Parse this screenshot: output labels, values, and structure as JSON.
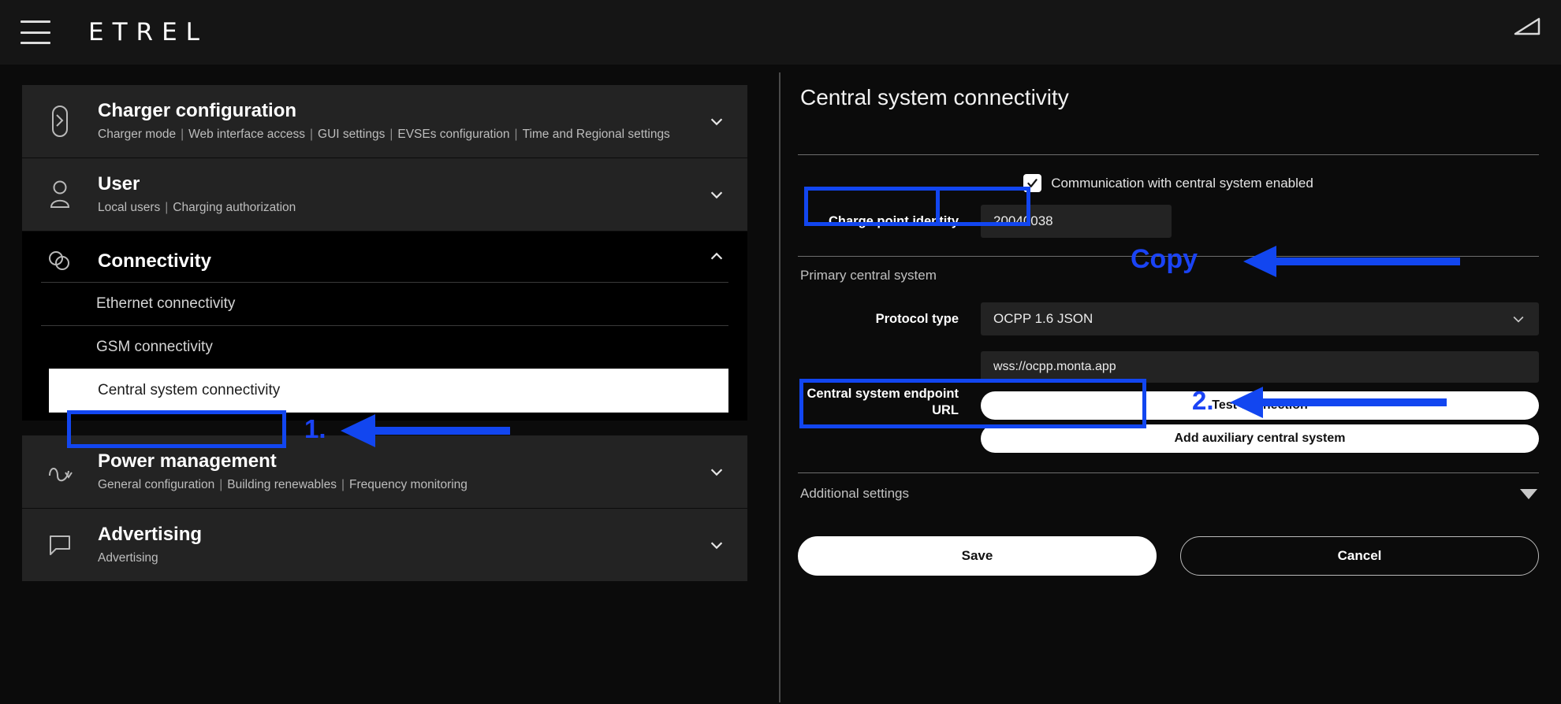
{
  "topbar": {
    "menu_icon": "hamburger-icon",
    "brand": "ETREL",
    "signal_icon": "signal-strength-icon"
  },
  "sidebar": {
    "sections": [
      {
        "icon": "charger-plug-icon",
        "title": "Charger configuration",
        "subitems": [
          "Charger mode",
          "Web interface access",
          "GUI settings",
          "EVSEs configuration",
          "Time and Regional settings"
        ],
        "expanded": false,
        "chevron": "chevron-down-icon"
      },
      {
        "icon": "user-icon",
        "title": "User",
        "subitems": [
          "Local users",
          "Charging authorization"
        ],
        "expanded": false,
        "chevron": "chevron-down-icon"
      },
      {
        "icon": "connectivity-icon",
        "title": "Connectivity",
        "expanded": true,
        "chevron": "chevron-up-icon",
        "items": [
          {
            "label": "Ethernet connectivity",
            "selected": false
          },
          {
            "label": "GSM connectivity",
            "selected": false
          },
          {
            "label": "Central system connectivity",
            "selected": true
          }
        ]
      },
      {
        "icon": "power-wave-icon",
        "title": "Power management",
        "subitems": [
          "General configuration",
          "Building renewables",
          "Frequency monitoring"
        ],
        "expanded": false,
        "chevron": "chevron-down-icon"
      },
      {
        "icon": "speech-bubble-icon",
        "title": "Advertising",
        "subitems": [
          "Advertising"
        ],
        "expanded": false,
        "chevron": "chevron-down-icon"
      }
    ]
  },
  "main": {
    "title": "Central system connectivity",
    "comm_checkbox": {
      "label": "Communication with central system enabled",
      "checked": true
    },
    "charge_point_identity": {
      "label": "Charge point identity",
      "value": "20040038"
    },
    "primary_section_label": "Primary central system",
    "protocol_type": {
      "label": "Protocol type",
      "value": "OCPP 1.6 JSON",
      "chevron": "chevron-down-icon"
    },
    "endpoint_url": {
      "label": "Central system endpoint URL",
      "value": "wss://ocpp.monta.app"
    },
    "test_connection_label": "Test connection",
    "add_auxiliary_label": "Add auxiliary central system",
    "additional_settings": {
      "label": "Additional settings",
      "chevron": "triangle-down-icon"
    },
    "save_label": "Save",
    "cancel_label": "Cancel"
  },
  "annotations": {
    "accent_color": "#1a43f5",
    "step1": "1.",
    "step2": "2.",
    "copy": "Copy"
  }
}
